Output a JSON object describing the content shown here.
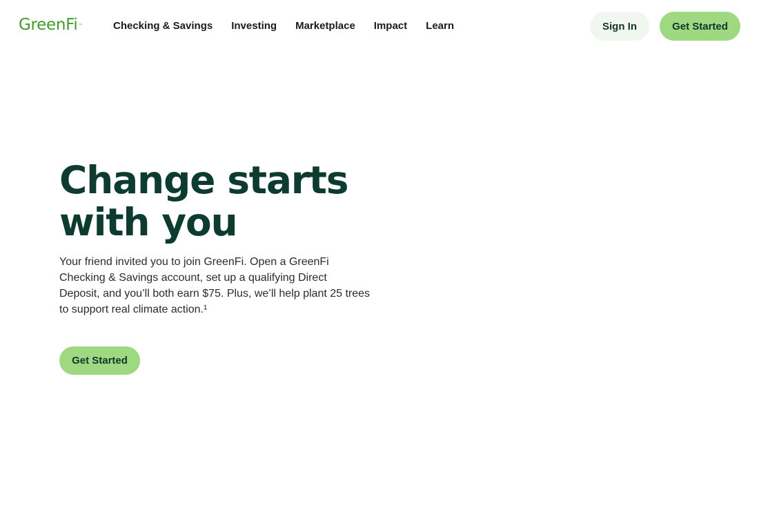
{
  "header": {
    "logo_text": "GreenFi",
    "logo_tm": "™",
    "nav": {
      "checking_savings": "Checking & Savings",
      "investing": "Investing",
      "marketplace": "Marketplace",
      "impact": "Impact",
      "learn": "Learn"
    },
    "sign_in_label": "Sign In",
    "get_started_label": "Get Started"
  },
  "hero": {
    "title_line1": "Change starts",
    "title_line2": "with you",
    "body_lines": [
      "Your friend invited you to join GreenFi. Open a GreenFi",
      "Checking & Savings account, set up a qualifying Direct",
      "Deposit, and you’ll both earn $75. Plus, we’ll help plant 25 trees",
      "to support real climate action.¹"
    ],
    "cta_label": "Get Started"
  },
  "colors": {
    "brand_green": "#3f9c27",
    "button_green": "#9ed982",
    "signin_bg": "#f1f7f0",
    "heading_dark": "#0e3b30"
  }
}
